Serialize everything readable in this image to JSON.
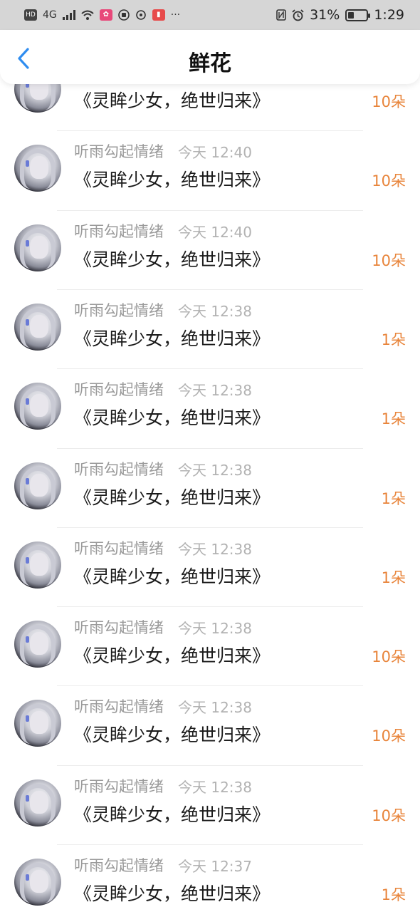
{
  "status_bar": {
    "left_icons": [
      "HD",
      "4G",
      "signal",
      "wifi",
      "app",
      "hand",
      "nfc-wallet",
      "book",
      "..."
    ],
    "hd_label": "HD",
    "network_label": "4G",
    "more_label": "···",
    "battery_text": "31%",
    "battery_level": 0.31,
    "time": "1:29"
  },
  "header": {
    "title": "鲜花",
    "back_icon": "chevron-left-icon"
  },
  "colors": {
    "accent_blue": "#2f8df0",
    "count_orange": "#e8843a",
    "muted_text": "#9a9a9a"
  },
  "rows": [
    {
      "name": "",
      "time": "",
      "message": "《灵眸少女，绝世归来》",
      "count": "10朵"
    },
    {
      "name": "听雨勾起情绪",
      "time": "今天 12:40",
      "message": "《灵眸少女，绝世归来》",
      "count": "10朵"
    },
    {
      "name": "听雨勾起情绪",
      "time": "今天 12:40",
      "message": "《灵眸少女，绝世归来》",
      "count": "10朵"
    },
    {
      "name": "听雨勾起情绪",
      "time": "今天 12:38",
      "message": "《灵眸少女，绝世归来》",
      "count": "1朵"
    },
    {
      "name": "听雨勾起情绪",
      "time": "今天 12:38",
      "message": "《灵眸少女，绝世归来》",
      "count": "1朵"
    },
    {
      "name": "听雨勾起情绪",
      "time": "今天 12:38",
      "message": "《灵眸少女，绝世归来》",
      "count": "1朵"
    },
    {
      "name": "听雨勾起情绪",
      "time": "今天 12:38",
      "message": "《灵眸少女，绝世归来》",
      "count": "1朵"
    },
    {
      "name": "听雨勾起情绪",
      "time": "今天 12:38",
      "message": "《灵眸少女，绝世归来》",
      "count": "10朵"
    },
    {
      "name": "听雨勾起情绪",
      "time": "今天 12:38",
      "message": "《灵眸少女，绝世归来》",
      "count": "10朵"
    },
    {
      "name": "听雨勾起情绪",
      "time": "今天 12:38",
      "message": "《灵眸少女，绝世归来》",
      "count": "10朵"
    },
    {
      "name": "听雨勾起情绪",
      "time": "今天 12:37",
      "message": "《灵眸少女，绝世归来》",
      "count": "1朵"
    }
  ]
}
